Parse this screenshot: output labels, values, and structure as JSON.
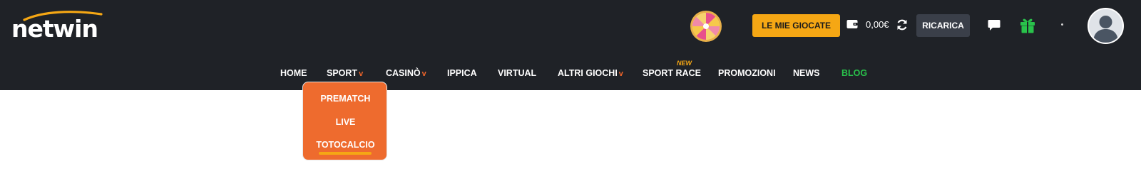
{
  "brand": {
    "name": "netwin"
  },
  "header": {
    "wheel": {
      "icon": "prize-wheel-icon"
    },
    "my_bets_label": "LE MIE GIOCATE",
    "balance": "0,00€",
    "recharge_label": "RICARICA",
    "icons": [
      "wallet-icon",
      "refresh-icon",
      "chat-icon",
      "gift-icon",
      "user-avatar"
    ]
  },
  "nav": {
    "items": [
      {
        "label": "HOME"
      },
      {
        "label": "SPORT",
        "chevron": "v"
      },
      {
        "label": "CASINÒ",
        "chevron": "v"
      },
      {
        "label": "IPPICA"
      },
      {
        "label": "VIRTUAL"
      },
      {
        "label": "ALTRI GIOCHI",
        "chevron": "v"
      },
      {
        "label": "SPORT RACE",
        "badge": "NEW"
      },
      {
        "label": "PROMOZIONI"
      },
      {
        "label": "NEWS"
      },
      {
        "label": "BLOG"
      }
    ]
  },
  "sport_dropdown": {
    "items": [
      {
        "label": "PREMATCH"
      },
      {
        "label": "LIVE"
      },
      {
        "label": "TOTOCALCIO",
        "active": true
      }
    ]
  },
  "colors": {
    "header_bg": "#1f2227",
    "accent_yellow": "#f5a714",
    "accent_orange": "#ee6b2e",
    "blog_green": "#29c24b",
    "button_dark": "#3a3f49"
  }
}
